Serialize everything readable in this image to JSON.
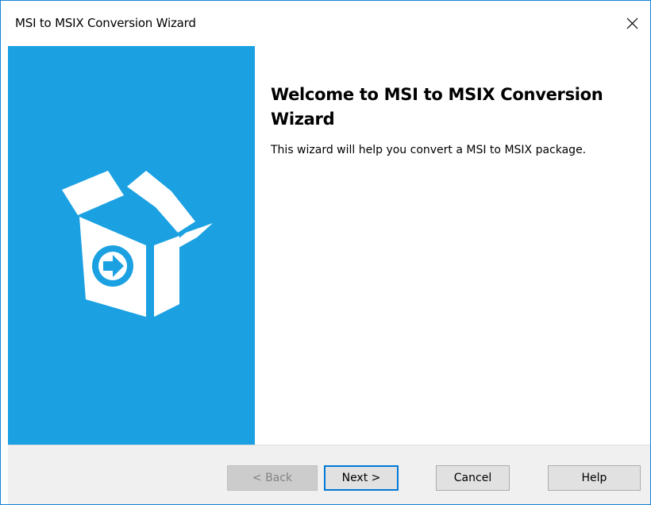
{
  "window": {
    "title": "MSI to MSIX Conversion Wizard",
    "close_glyph": "✕",
    "accent_color": "#1ba1e2",
    "border_color": "#1883d7"
  },
  "side_panel": {
    "icon": "package-convert-icon",
    "color": "#1ba1e2"
  },
  "content": {
    "heading": "Welcome to MSI to MSIX Conversion Wizard",
    "description": "This wizard will help you convert a MSI to MSIX package."
  },
  "footer": {
    "back_label": "< Back",
    "back_enabled": false,
    "next_label": "Next >",
    "next_is_default": true,
    "cancel_label": "Cancel",
    "help_label": "Help"
  }
}
